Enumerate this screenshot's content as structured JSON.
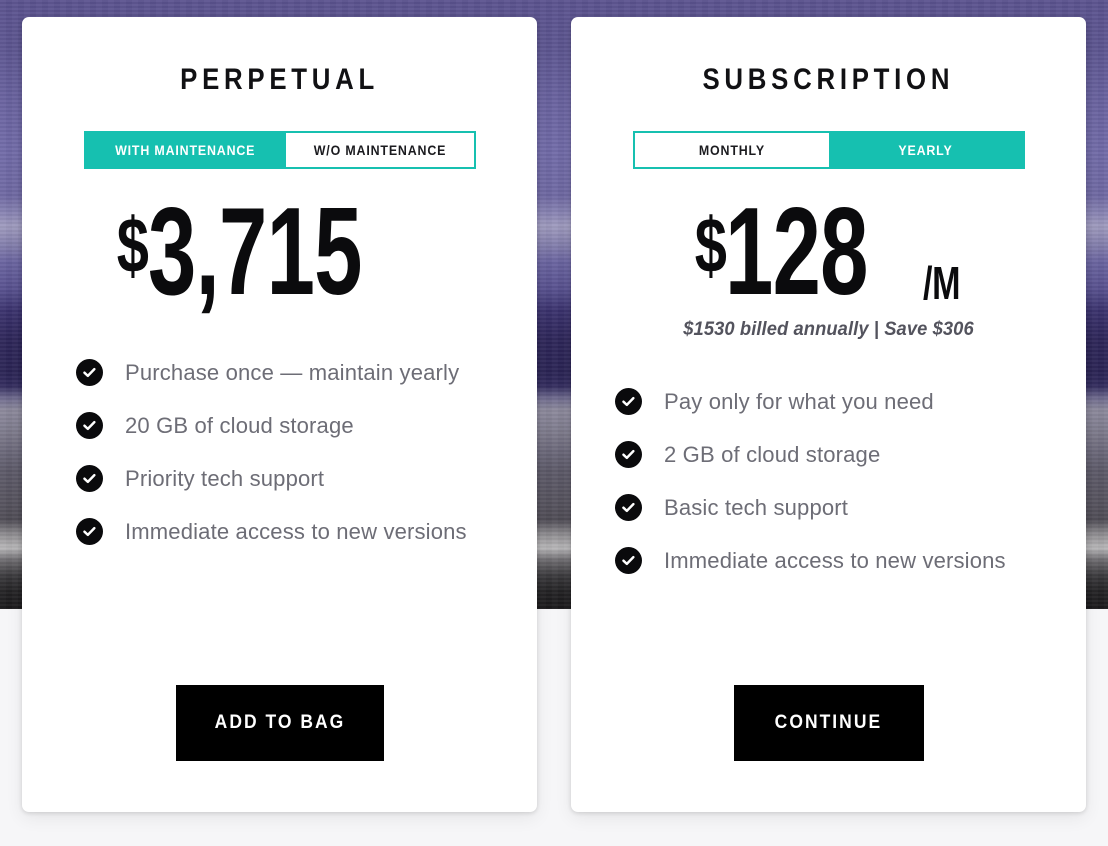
{
  "background": {
    "photo_top_color": "#6a63a0",
    "photo_mid_color": "#2b2455",
    "photo_bottom_color": "#1b1a1c",
    "page_color": "#f6f6f8"
  },
  "theme": {
    "accent_teal": "#16c0b0",
    "text_dark": "#111114",
    "text_muted": "#6d6d76",
    "cta_bg": "#000000",
    "card_bg": "#ffffff"
  },
  "plans": [
    {
      "title": "PERPETUAL",
      "toggle": {
        "options": [
          "WITH MAINTENANCE",
          "W/O MAINTENANCE"
        ],
        "selected": "WITH MAINTENANCE"
      },
      "price": {
        "currency": "$",
        "amount": "3,715",
        "per": "",
        "note": ""
      },
      "features": [
        "Purchase once — maintain yearly",
        "20 GB of cloud storage",
        "Priority tech support",
        "Immediate access to new versions"
      ],
      "cta": "ADD TO BAG"
    },
    {
      "title": "SUBSCRIPTION",
      "toggle": {
        "options": [
          "MONTHLY",
          "YEARLY"
        ],
        "selected": "YEARLY"
      },
      "price": {
        "currency": "$",
        "amount": "128",
        "per": "/M",
        "note": "$1530 billed annually | Save $306"
      },
      "features": [
        "Pay only for what you need",
        "2 GB of cloud storage",
        "Basic tech support",
        "Immediate access to new versions"
      ],
      "cta": "CONTINUE"
    }
  ],
  "icons": {
    "check": "check-circle-icon"
  }
}
